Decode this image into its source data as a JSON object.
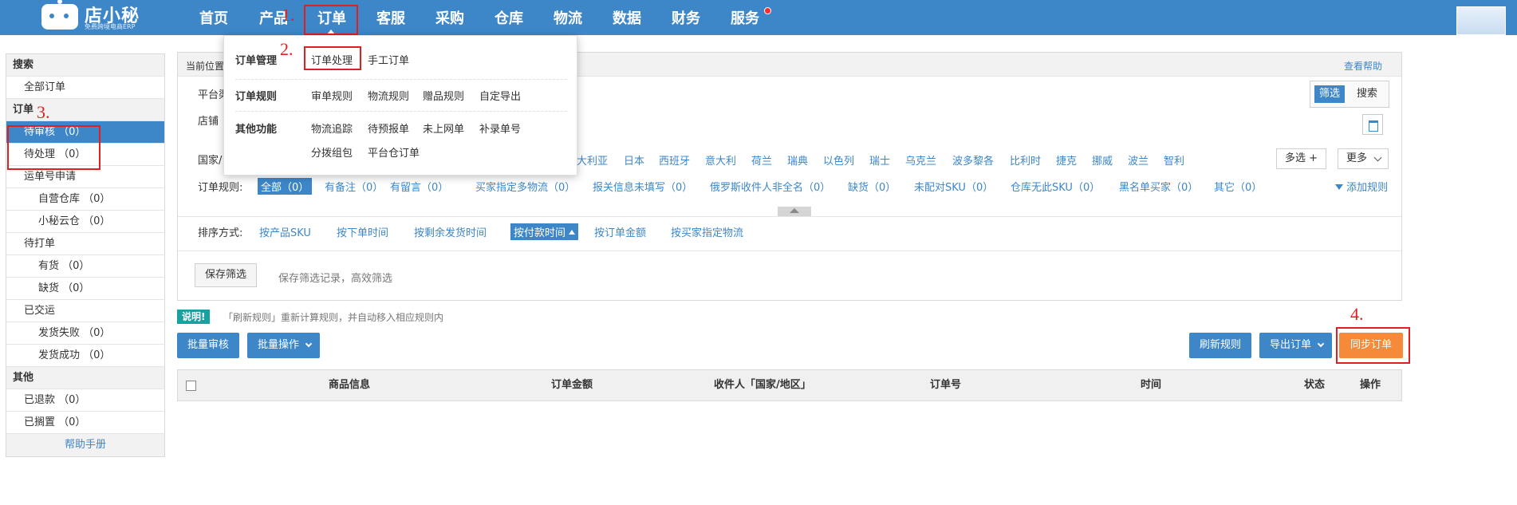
{
  "nav": {
    "logo_name": "店小秘",
    "logo_sub": "免费跨境电商ERP",
    "items": [
      "首页",
      "产品",
      "订单",
      "客服",
      "采购",
      "仓库",
      "物流",
      "数据",
      "财务",
      "服务"
    ]
  },
  "annotations": [
    "1.",
    "2.",
    "3.",
    "4."
  ],
  "dropdown": {
    "groups": [
      {
        "label": "订单管理",
        "items": [
          "订单处理",
          "手工订单"
        ]
      },
      {
        "label": "订单规则",
        "items": [
          "审单规则",
          "物流规则",
          "赠品规则",
          "自定导出"
        ]
      },
      {
        "label": "其他功能",
        "items": [
          "物流追踪",
          "待预报单",
          "未上网单",
          "补录单号",
          "分拨组包",
          "平台仓订单"
        ]
      }
    ]
  },
  "sidebar": {
    "search_head": "搜索",
    "all_orders": "全部订单",
    "order_head": "订单",
    "pending_review": "待审核 （0）",
    "pending_process": "待处理 （0）",
    "waybill_apply": "运单号申请",
    "own_warehouse": "自营仓库 （0）",
    "cloud_warehouse": "小秘云仓 （0）",
    "to_print": "待打单",
    "in_stock": "有货 （0）",
    "out_of_stock": "缺货 （0）",
    "shipped": "已交运",
    "ship_failed": "发货失败 （0）",
    "ship_success": "发货成功 （0）",
    "other_head": "其他",
    "refunded": "已退款 （0）",
    "on_hold": "已搁置 （0）",
    "help": "帮助手册"
  },
  "panel": {
    "location": "当前位置",
    "help_link": "查看帮助",
    "platform_label": "平台渠",
    "shop_label": "店铺",
    "filter_btn": "筛选",
    "search_btn": "搜索",
    "country_label": "国家/",
    "countries": [
      "大利亚",
      "日本",
      "西班牙",
      "意大利",
      "荷兰",
      "瑞典",
      "以色列",
      "瑞士",
      "乌克兰",
      "波多黎各",
      "比利时",
      "捷克",
      "挪威",
      "波兰",
      "智利"
    ],
    "multi_select": "多选 +",
    "more": "更多",
    "rule_label": "订单规则:",
    "rules": [
      "全部（0）",
      "有备注（0）",
      "有留言（0）",
      "买家指定多物流（0）",
      "报关信息未填写（0）",
      "俄罗斯收件人非全名（0）",
      "缺货（0）",
      "未配对SKU（0）",
      "仓库无此SKU（0）",
      "黑名单买家（0）",
      "其它（0）"
    ],
    "add_rule": "添加规则",
    "sort_label": "排序方式:",
    "sorts": [
      "按产品SKU",
      "按下单时间",
      "按剩余发货时间",
      "按付款时间",
      "按订单金额",
      "按买家指定物流"
    ],
    "save_filter": "保存筛选",
    "save_hint": "保存筛选记录，高效筛选"
  },
  "tip": {
    "badge": "说明!",
    "text": "「刷新规则」重新计算规则，并自动移入相应规则内"
  },
  "actions": {
    "batch_review": "批量审核",
    "batch_ops": "批量操作",
    "refresh_rules": "刷新规则",
    "export_orders": "导出订单",
    "sync_orders": "同步订单"
  },
  "table": {
    "columns": [
      "商品信息",
      "订单金额",
      "收件人「国家/地区」",
      "订单号",
      "时间",
      "状态",
      "操作"
    ]
  }
}
